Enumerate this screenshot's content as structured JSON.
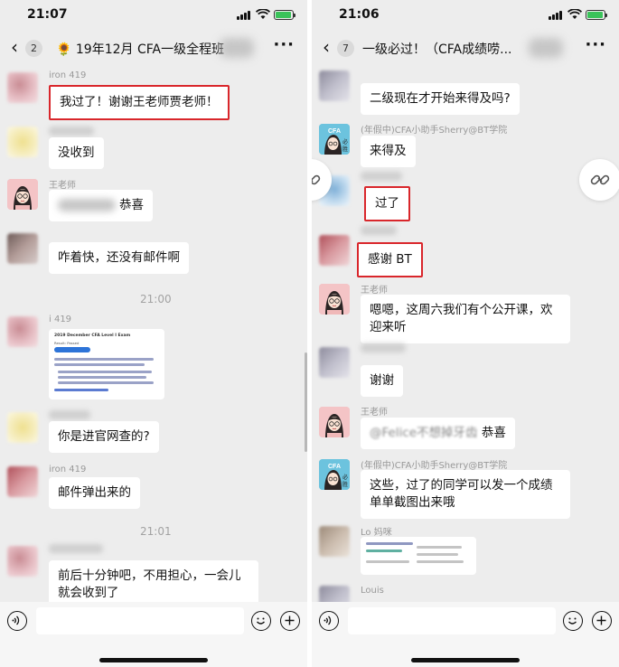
{
  "left": {
    "status_time": "21:07",
    "back_count": "2",
    "title": "🌻 19年12月 CFA一级全程班",
    "messages": {
      "m1_name": "iron 419",
      "m1_text": "我过了！谢谢王老师贾老师！",
      "m2_text": "没收到",
      "m3_name": "王老师",
      "m3_text": "恭喜",
      "m4_text": "咋着快，还没有邮件啊",
      "sep1": "21:00",
      "m5_name": "i 419",
      "m6_text": "你是进官网查的?",
      "m7_name": "iron 419",
      "m7_text": "邮件弹出来的",
      "sep2": "21:01",
      "m8_text": "前后十分钟吧，不用担心，一会儿就会收到了"
    },
    "card": {
      "title": "2019 December CFA Level I Exam",
      "subtitle": "Result: Passed",
      "button": "View Result Details (PDF)"
    }
  },
  "right": {
    "status_time": "21:06",
    "back_count": "7",
    "title": "一级必过！（CFA成绩唠...",
    "messages": {
      "r1_text": "二级现在才开始来得及吗?",
      "r2_name": "(年假中)CFA小助手Sherry@BT学院",
      "r2_text": "来得及",
      "r3_text": "过了",
      "r4_text": "感谢 BT",
      "r5_name": "王老师",
      "r5_text": "嗯嗯，这周六我们有个公开课，欢迎来听",
      "r6_text": "谢谢",
      "r7_name": "王老师",
      "r7_text_prefix": "@Felice不想掉牙齿",
      "r7_text": "恭喜",
      "r8_name": "(年假中)CFA小助手Sherry@BT学院",
      "r8_text": "这些，过了的同学可以发一个成绩单单截图出来哦",
      "r9_name": "Lo 妈咪",
      "r10_name": "Louis"
    }
  },
  "icons": {
    "back": "chevron-left-icon",
    "more": "more-icon",
    "voice": "voice-icon",
    "emoji": "emoji-icon",
    "plus": "plus-icon",
    "link": "link-icon"
  },
  "colors": {
    "chat_bg": "#ededed",
    "bubble": "#ffffff",
    "highlight_box": "#d9262b",
    "teacher_avatar": "#f4c4c6",
    "cfa_avatar": "#6cc3de"
  }
}
